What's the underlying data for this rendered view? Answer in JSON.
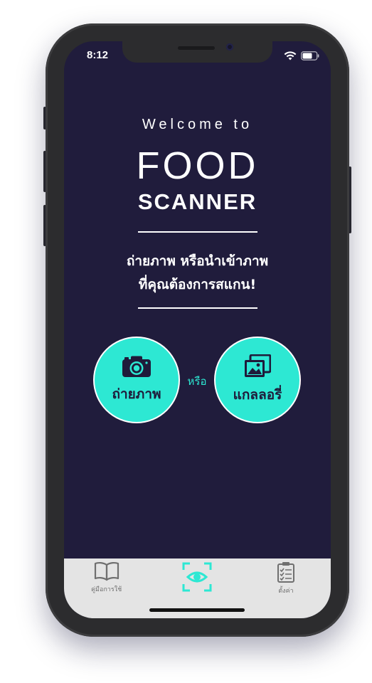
{
  "status_bar": {
    "time": "8:12",
    "icons": [
      "wifi-icon",
      "battery-icon"
    ]
  },
  "hero": {
    "welcome": "Welcome to",
    "title_line1": "FOOD",
    "title_line2": "SCANNER"
  },
  "subtitle": {
    "line1": "ถ่ายภาพ หรือนำเข้าภาพ",
    "line2": "ที่คุณต้องการสแกน!"
  },
  "actions": {
    "camera_label": "ถ่ายภาพ",
    "or_label": "หรือ",
    "gallery_label": "แกลลอรี่",
    "camera_icon": "camera-icon",
    "gallery_icon": "gallery-icon"
  },
  "tabbar": {
    "guide_label": "คู่มือการใช้",
    "scan_icon": "scan-icon",
    "settings_label": "ตั้งค่า"
  },
  "colors": {
    "background": "#201c3c",
    "accent": "#2de8d3",
    "tabbar": "#e4e4e4",
    "text": "#ffffff"
  }
}
